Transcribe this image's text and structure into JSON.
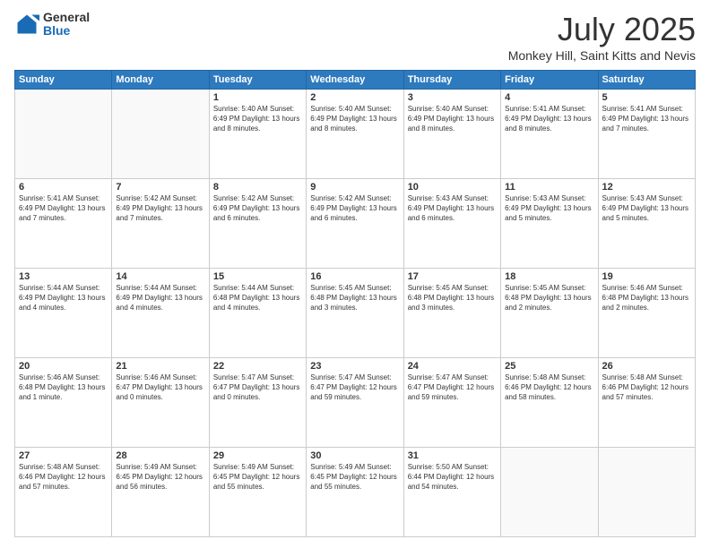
{
  "header": {
    "logo_general": "General",
    "logo_blue": "Blue",
    "month_title": "July 2025",
    "location": "Monkey Hill, Saint Kitts and Nevis"
  },
  "days_of_week": [
    "Sunday",
    "Monday",
    "Tuesday",
    "Wednesday",
    "Thursday",
    "Friday",
    "Saturday"
  ],
  "weeks": [
    [
      {
        "day": "",
        "detail": ""
      },
      {
        "day": "",
        "detail": ""
      },
      {
        "day": "1",
        "detail": "Sunrise: 5:40 AM\nSunset: 6:49 PM\nDaylight: 13 hours\nand 8 minutes."
      },
      {
        "day": "2",
        "detail": "Sunrise: 5:40 AM\nSunset: 6:49 PM\nDaylight: 13 hours\nand 8 minutes."
      },
      {
        "day": "3",
        "detail": "Sunrise: 5:40 AM\nSunset: 6:49 PM\nDaylight: 13 hours\nand 8 minutes."
      },
      {
        "day": "4",
        "detail": "Sunrise: 5:41 AM\nSunset: 6:49 PM\nDaylight: 13 hours\nand 8 minutes."
      },
      {
        "day": "5",
        "detail": "Sunrise: 5:41 AM\nSunset: 6:49 PM\nDaylight: 13 hours\nand 7 minutes."
      }
    ],
    [
      {
        "day": "6",
        "detail": "Sunrise: 5:41 AM\nSunset: 6:49 PM\nDaylight: 13 hours\nand 7 minutes."
      },
      {
        "day": "7",
        "detail": "Sunrise: 5:42 AM\nSunset: 6:49 PM\nDaylight: 13 hours\nand 7 minutes."
      },
      {
        "day": "8",
        "detail": "Sunrise: 5:42 AM\nSunset: 6:49 PM\nDaylight: 13 hours\nand 6 minutes."
      },
      {
        "day": "9",
        "detail": "Sunrise: 5:42 AM\nSunset: 6:49 PM\nDaylight: 13 hours\nand 6 minutes."
      },
      {
        "day": "10",
        "detail": "Sunrise: 5:43 AM\nSunset: 6:49 PM\nDaylight: 13 hours\nand 6 minutes."
      },
      {
        "day": "11",
        "detail": "Sunrise: 5:43 AM\nSunset: 6:49 PM\nDaylight: 13 hours\nand 5 minutes."
      },
      {
        "day": "12",
        "detail": "Sunrise: 5:43 AM\nSunset: 6:49 PM\nDaylight: 13 hours\nand 5 minutes."
      }
    ],
    [
      {
        "day": "13",
        "detail": "Sunrise: 5:44 AM\nSunset: 6:49 PM\nDaylight: 13 hours\nand 4 minutes."
      },
      {
        "day": "14",
        "detail": "Sunrise: 5:44 AM\nSunset: 6:49 PM\nDaylight: 13 hours\nand 4 minutes."
      },
      {
        "day": "15",
        "detail": "Sunrise: 5:44 AM\nSunset: 6:48 PM\nDaylight: 13 hours\nand 4 minutes."
      },
      {
        "day": "16",
        "detail": "Sunrise: 5:45 AM\nSunset: 6:48 PM\nDaylight: 13 hours\nand 3 minutes."
      },
      {
        "day": "17",
        "detail": "Sunrise: 5:45 AM\nSunset: 6:48 PM\nDaylight: 13 hours\nand 3 minutes."
      },
      {
        "day": "18",
        "detail": "Sunrise: 5:45 AM\nSunset: 6:48 PM\nDaylight: 13 hours\nand 2 minutes."
      },
      {
        "day": "19",
        "detail": "Sunrise: 5:46 AM\nSunset: 6:48 PM\nDaylight: 13 hours\nand 2 minutes."
      }
    ],
    [
      {
        "day": "20",
        "detail": "Sunrise: 5:46 AM\nSunset: 6:48 PM\nDaylight: 13 hours\nand 1 minute."
      },
      {
        "day": "21",
        "detail": "Sunrise: 5:46 AM\nSunset: 6:47 PM\nDaylight: 13 hours\nand 0 minutes."
      },
      {
        "day": "22",
        "detail": "Sunrise: 5:47 AM\nSunset: 6:47 PM\nDaylight: 13 hours\nand 0 minutes."
      },
      {
        "day": "23",
        "detail": "Sunrise: 5:47 AM\nSunset: 6:47 PM\nDaylight: 12 hours\nand 59 minutes."
      },
      {
        "day": "24",
        "detail": "Sunrise: 5:47 AM\nSunset: 6:47 PM\nDaylight: 12 hours\nand 59 minutes."
      },
      {
        "day": "25",
        "detail": "Sunrise: 5:48 AM\nSunset: 6:46 PM\nDaylight: 12 hours\nand 58 minutes."
      },
      {
        "day": "26",
        "detail": "Sunrise: 5:48 AM\nSunset: 6:46 PM\nDaylight: 12 hours\nand 57 minutes."
      }
    ],
    [
      {
        "day": "27",
        "detail": "Sunrise: 5:48 AM\nSunset: 6:46 PM\nDaylight: 12 hours\nand 57 minutes."
      },
      {
        "day": "28",
        "detail": "Sunrise: 5:49 AM\nSunset: 6:45 PM\nDaylight: 12 hours\nand 56 minutes."
      },
      {
        "day": "29",
        "detail": "Sunrise: 5:49 AM\nSunset: 6:45 PM\nDaylight: 12 hours\nand 55 minutes."
      },
      {
        "day": "30",
        "detail": "Sunrise: 5:49 AM\nSunset: 6:45 PM\nDaylight: 12 hours\nand 55 minutes."
      },
      {
        "day": "31",
        "detail": "Sunrise: 5:50 AM\nSunset: 6:44 PM\nDaylight: 12 hours\nand 54 minutes."
      },
      {
        "day": "",
        "detail": ""
      },
      {
        "day": "",
        "detail": ""
      }
    ]
  ]
}
